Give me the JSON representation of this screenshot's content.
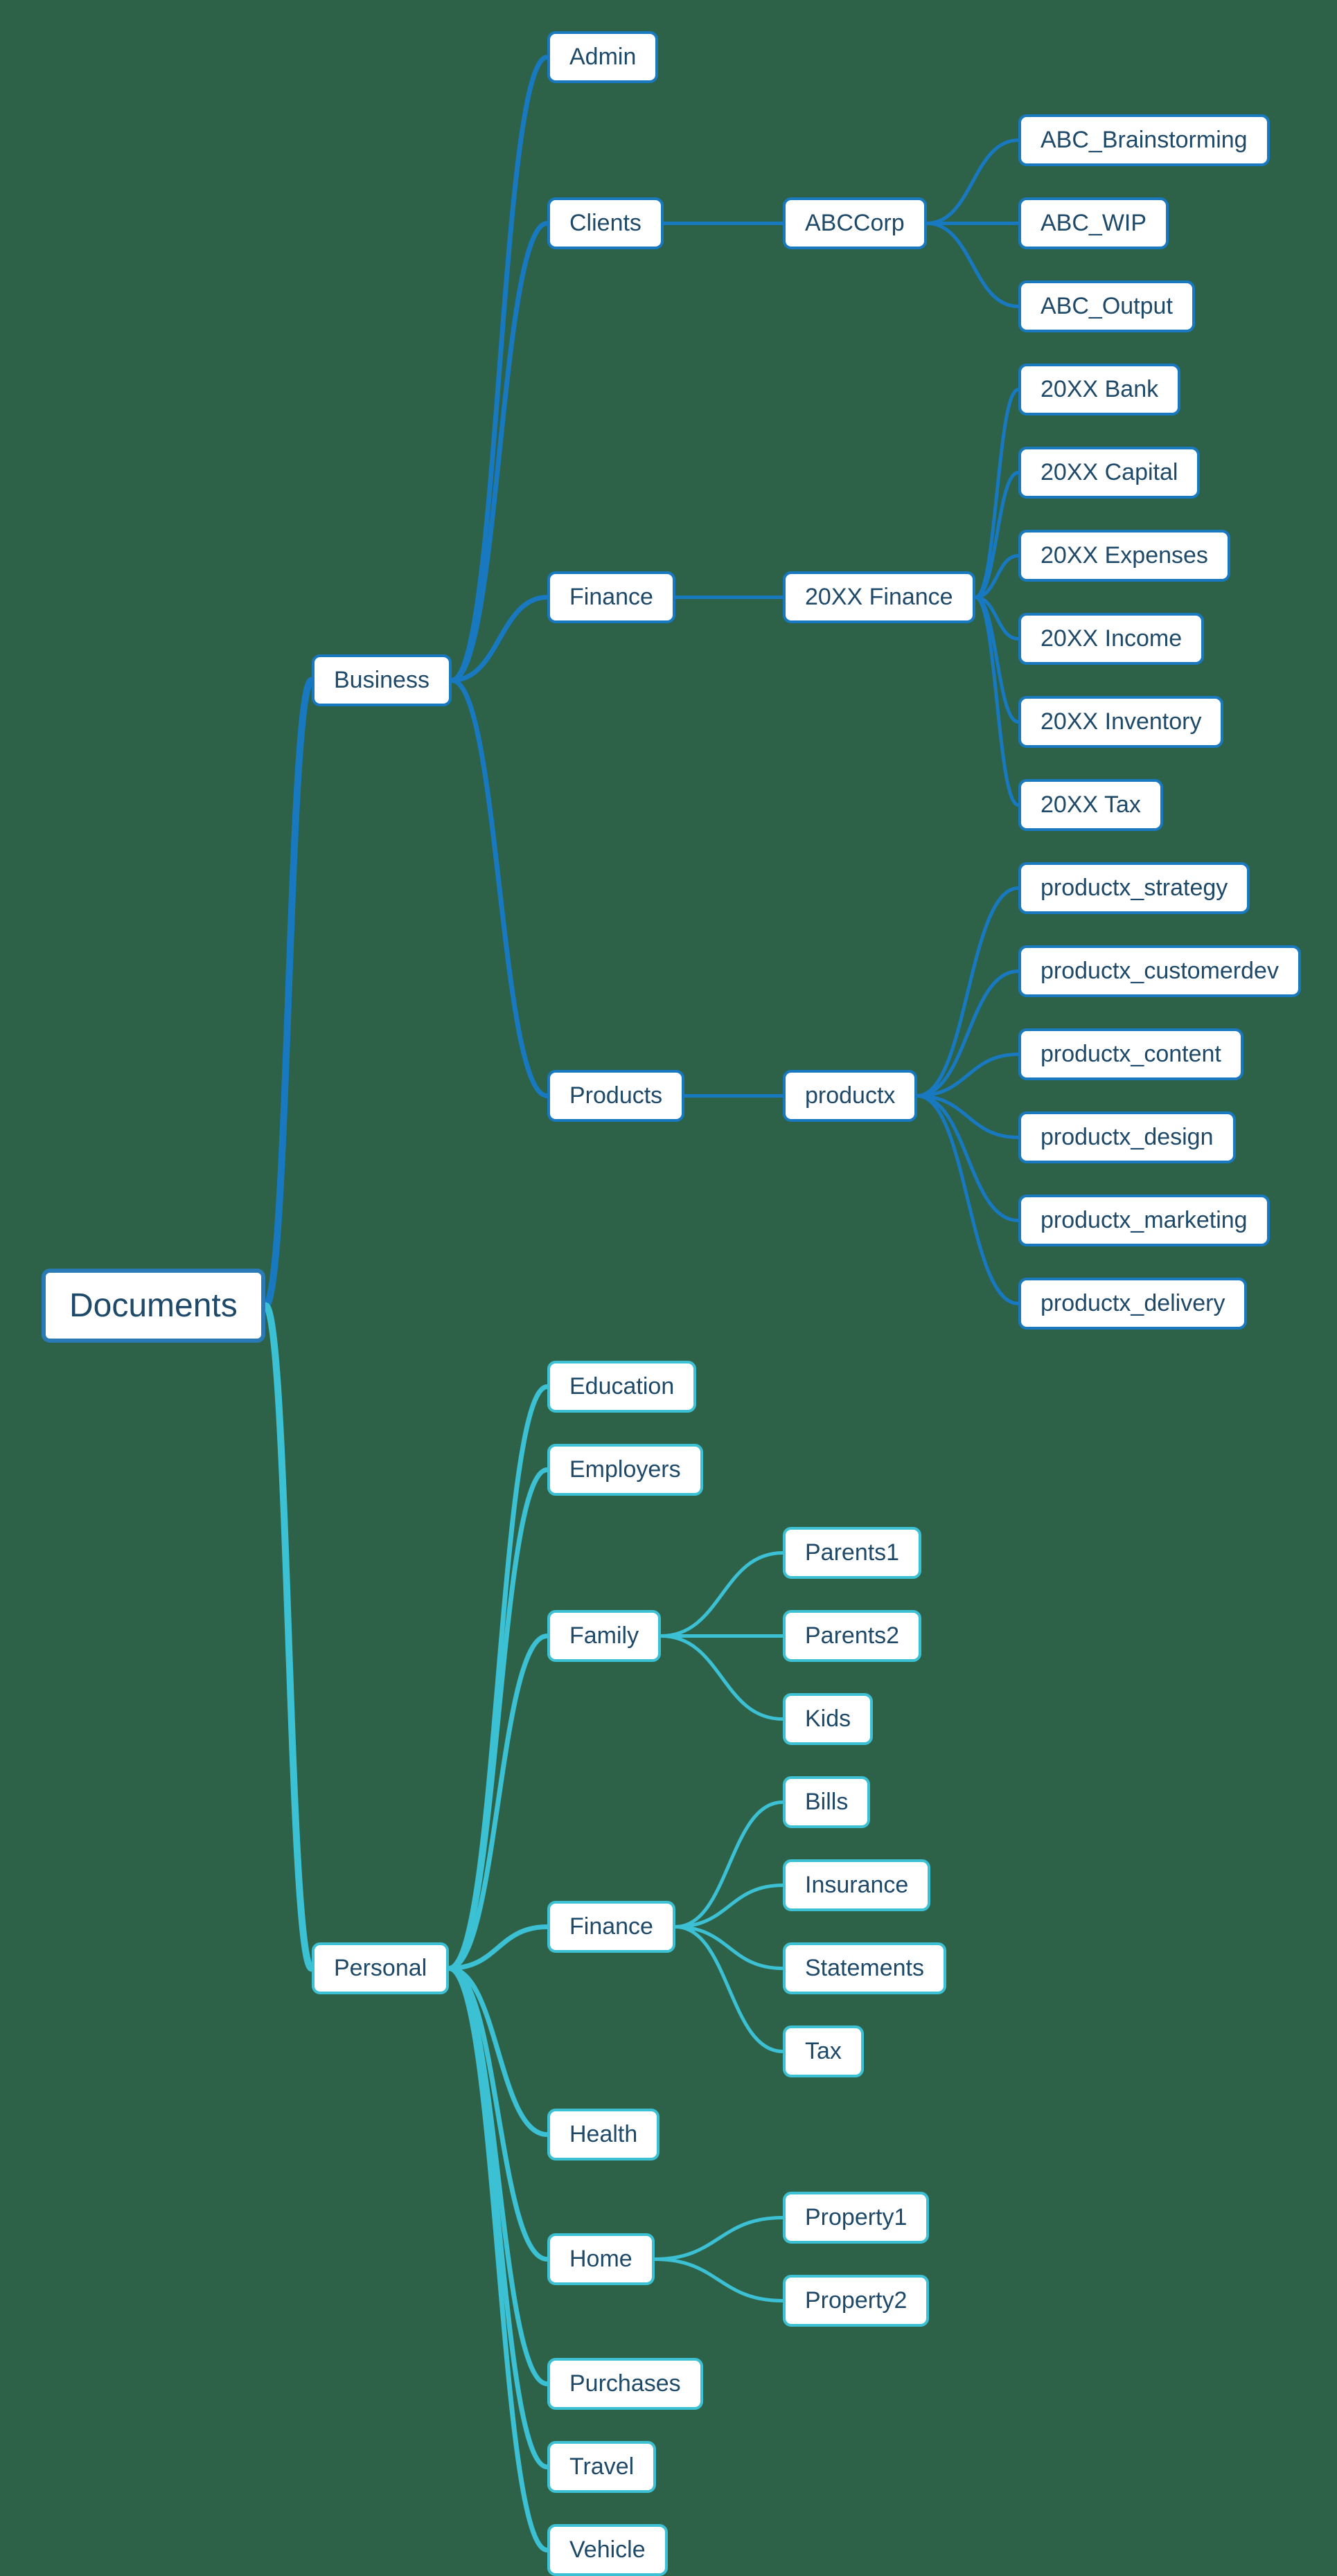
{
  "colors": {
    "business": "#1879c0",
    "personal": "#3cc0d4"
  },
  "tree": {
    "label": "Documents",
    "children": [
      {
        "label": "Business",
        "color": "business",
        "children": [
          {
            "label": "Admin"
          },
          {
            "label": "Clients",
            "children": [
              {
                "label": "ABCCorp",
                "children": [
                  {
                    "label": "ABC_Brainstorming"
                  },
                  {
                    "label": "ABC_WIP"
                  },
                  {
                    "label": "ABC_Output"
                  }
                ]
              }
            ]
          },
          {
            "label": "Finance",
            "children": [
              {
                "label": "20XX Finance",
                "children": [
                  {
                    "label": "20XX Bank"
                  },
                  {
                    "label": "20XX Capital"
                  },
                  {
                    "label": "20XX Expenses"
                  },
                  {
                    "label": "20XX Income"
                  },
                  {
                    "label": "20XX Inventory"
                  },
                  {
                    "label": "20XX Tax"
                  }
                ]
              }
            ]
          },
          {
            "label": "Products",
            "children": [
              {
                "label": "productx",
                "children": [
                  {
                    "label": "productx_strategy"
                  },
                  {
                    "label": "productx_customerdev"
                  },
                  {
                    "label": "productx_content"
                  },
                  {
                    "label": "productx_design"
                  },
                  {
                    "label": "productx_marketing"
                  },
                  {
                    "label": "productx_delivery"
                  }
                ]
              }
            ]
          }
        ]
      },
      {
        "label": "Personal",
        "color": "personal",
        "children": [
          {
            "label": "Education"
          },
          {
            "label": "Employers"
          },
          {
            "label": "Family",
            "children": [
              {
                "label": "Parents1"
              },
              {
                "label": "Parents2"
              },
              {
                "label": "Kids"
              }
            ]
          },
          {
            "label": "Finance",
            "children": [
              {
                "label": "Bills"
              },
              {
                "label": "Insurance"
              },
              {
                "label": "Statements"
              },
              {
                "label": "Tax"
              }
            ]
          },
          {
            "label": "Health"
          },
          {
            "label": "Home",
            "children": [
              {
                "label": "Property1"
              },
              {
                "label": "Property2"
              }
            ]
          },
          {
            "label": "Purchases"
          },
          {
            "label": "Travel"
          },
          {
            "label": "Vehicle"
          }
        ]
      }
    ]
  },
  "layout": {
    "rootX": 60,
    "columnX": [
      450,
      790,
      1130,
      1470
    ],
    "leafVspace": 120,
    "nodeHeight": 70,
    "topMargin": 80
  }
}
